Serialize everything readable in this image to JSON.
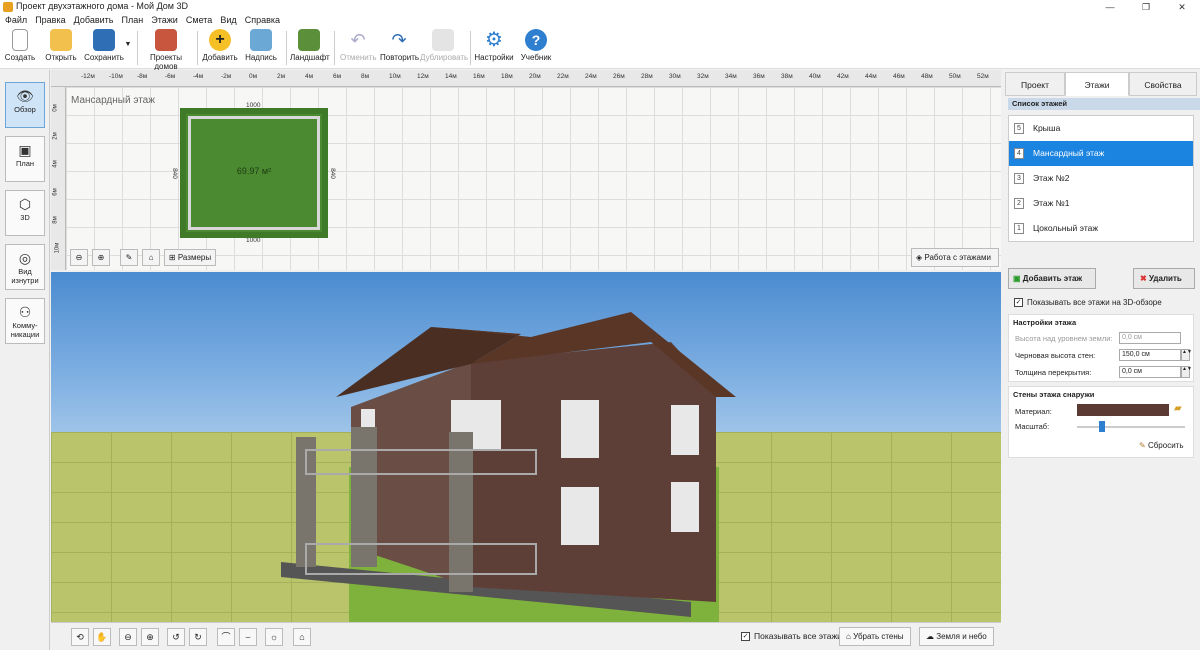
{
  "window": {
    "title": "Проект двухэтажного дома - Мой Дом 3D",
    "controls": [
      "—",
      "❐",
      "✕"
    ]
  },
  "menu": [
    "Файл",
    "Правка",
    "Добавить",
    "План",
    "Этажи",
    "Смета",
    "Вид",
    "Справка"
  ],
  "toolbar": {
    "create": "Создать",
    "open": "Открыть",
    "save": "Сохранить",
    "projects": "Проекты домов",
    "add": "Добавить",
    "label": "Надпись",
    "landscape": "Ландшафт",
    "undo": "Отменить",
    "redo": "Повторить",
    "duplicate": "Дублировать",
    "settings": "Настройки",
    "tutorial": "Учебник"
  },
  "leftbar": {
    "overview": "Обзор",
    "plan": "План",
    "view3d": "3D",
    "inside": "Вид изнутри",
    "comm": "Комму-никации"
  },
  "plan": {
    "floor_name": "Мансардный этаж",
    "area": "69.97 м²",
    "dim_top": "1000",
    "dim_bottom": "1000",
    "dim_left": "840",
    "dim_right": "840",
    "ruler_top": [
      "-12м",
      "-10м",
      "-8м",
      "-6м",
      "-4м",
      "-2м",
      "0м",
      "2м",
      "4м",
      "6м",
      "8м",
      "10м",
      "12м",
      "14м",
      "16м",
      "18м",
      "20м",
      "22м",
      "24м",
      "26м",
      "28м",
      "30м",
      "32м",
      "34м",
      "36м",
      "38м",
      "40м",
      "42м",
      "44м",
      "46м",
      "48м",
      "50м",
      "52м"
    ],
    "ruler_left": [
      "0м",
      "2м",
      "4м",
      "6м",
      "8м",
      "10м"
    ],
    "sizes_btn": "Размеры",
    "floors_btn": "Работа с этажами"
  },
  "bottom": {
    "show_all": "Показывать все этажи",
    "show_all_checked": true,
    "remove_walls": "Убрать стены",
    "ground_sky": "Земля и небо"
  },
  "panel": {
    "tabs": [
      "Проект",
      "Этажи",
      "Свойства"
    ],
    "active_tab": "Этажи",
    "floors_header": "Список этажей",
    "floors": [
      {
        "num": "5",
        "name": "Крыша"
      },
      {
        "num": "4",
        "name": "Мансардный этаж"
      },
      {
        "num": "3",
        "name": "Этаж №2"
      },
      {
        "num": "2",
        "name": "Этаж №1"
      },
      {
        "num": "1",
        "name": "Цокольный этаж"
      }
    ],
    "selected_floor": "Мансардный этаж",
    "add_floor": "Добавить этаж",
    "delete": "Удалить",
    "show_3d": "Показывать все этажи на 3D-обзоре",
    "settings_title": "Настройки этажа",
    "height_label": "Высота над уровнем земли:",
    "height_value": "0,0 см",
    "wall_label": "Черновая высота стен:",
    "wall_value": "150,0 см",
    "slab_label": "Толщина перекрытия:",
    "slab_value": "0,0 см",
    "walls_title": "Стены этажа снаружи",
    "material_label": "Материал:",
    "scale_label": "Масштаб:",
    "scale_level": 0.2,
    "reset": "Сбросить"
  }
}
